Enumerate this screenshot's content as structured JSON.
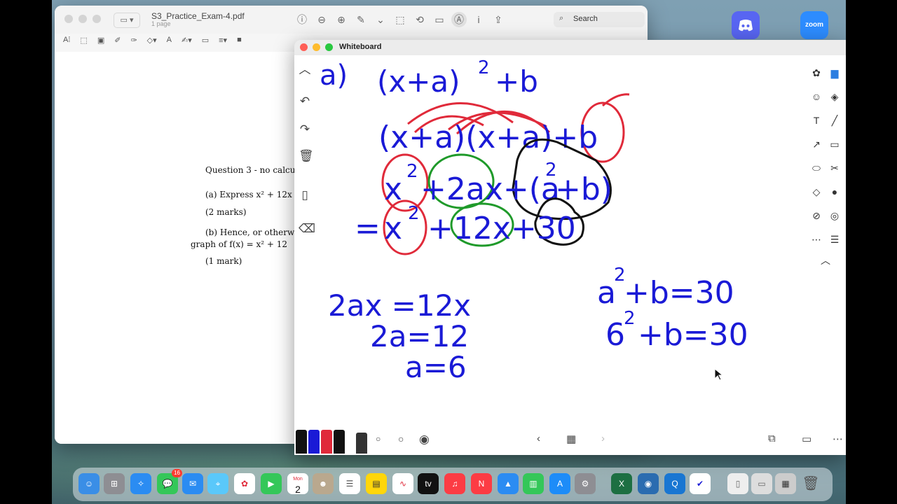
{
  "pdf": {
    "title": "S3_Practice_Exam-4.pdf",
    "subtitle": "1 page",
    "search_placeholder": "Search",
    "question_title": "Question 3 - no calcu",
    "part_a": "(a) Express x² + 12x",
    "part_a_marks": "(2 marks)",
    "part_b": "(b) Hence, or otherw",
    "part_b_cont": "graph of f(x) = x² + 12",
    "part_b_marks": "(1 mark)"
  },
  "whiteboard": {
    "title": "Whiteboard",
    "ink_blue": "#1a1ad6",
    "ink_red": "#e02a3a",
    "ink_green": "#1f9a2a",
    "ink_black": "#111111",
    "lines": {
      "l1_part": "a)",
      "l1_expr": "(x+a)",
      "l1_exp": "2",
      "l1_tail": "+b",
      "l2": "(x+a)(x+a)+b",
      "l3_a": "x",
      "l3_a_exp": "2",
      "l3_b": "+2ax+(a",
      "l3_c_exp": "2",
      "l3_d": "+b)",
      "l4_eq": "=",
      "l4_a": "x",
      "l4_a_exp": "2",
      "l4_b": "+12x+30",
      "r1_a": "a",
      "r1_a_exp": "2",
      "r1_b": "+b=30",
      "r2_a": "6",
      "r2_a_exp": "2",
      "r2_b": "+b=30",
      "s1": "2ax =12x",
      "s2": "2a=12",
      "s3": "a=6"
    }
  },
  "desktop": {
    "discord_label": "Discord",
    "zoom_label": "zoom"
  },
  "dock": {
    "calendar_month": "Mon",
    "calendar_day": "2",
    "messages_badge": "16"
  }
}
